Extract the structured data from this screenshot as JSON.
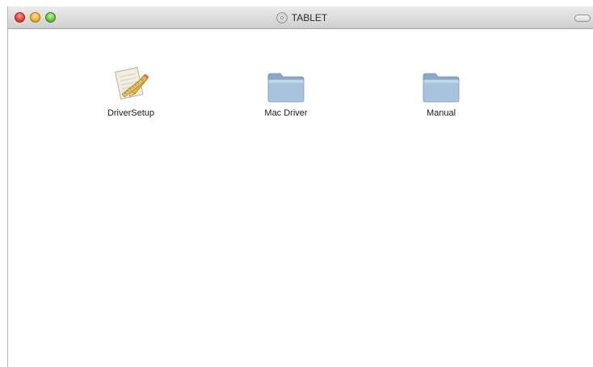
{
  "window": {
    "title": "TABLET"
  },
  "items": [
    {
      "label": "DriverSetup",
      "icon": "installer-app-icon"
    },
    {
      "label": "Mac Driver",
      "icon": "folder-icon"
    },
    {
      "label": "Manual",
      "icon": "folder-icon"
    }
  ],
  "colors": {
    "folder": "#a9c3dd",
    "folder_dark": "#8aa9c9",
    "close": "#e2463a",
    "minimize": "#f1b53a",
    "zoom": "#6cc644"
  }
}
